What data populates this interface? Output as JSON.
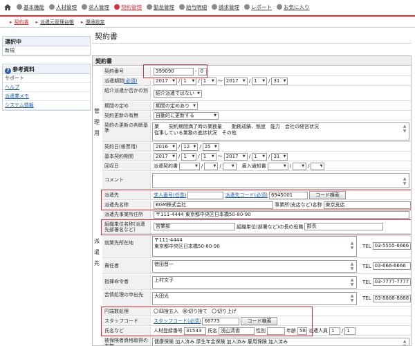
{
  "topnav": [
    "基本機能",
    "人材管理",
    "求人管理",
    "契約管理",
    "勤怠管理",
    "給与明細",
    "請求管理",
    "レポート",
    "お気に入り"
  ],
  "subnav": [
    "契約書",
    "派遣元管理台帳",
    "環境設定"
  ],
  "page_title": "契約書",
  "sidebar": {
    "selected_head": "選択中",
    "selected_item": "新規",
    "ref_head": "参考資料",
    "ref_items": [
      "サポート",
      "ヘルプ",
      "派遣業メモ",
      "システム情報"
    ]
  },
  "main": {
    "section_title": "契約書",
    "group_kanri": "管理用",
    "group_haken": "派遣先",
    "contract_no": {
      "label": "契約番号",
      "value": "399090",
      "sep": "-",
      "sub": "0"
    },
    "haken_period": {
      "label": "派遣期間",
      "required": "(必須)",
      "from": [
        "2017",
        "1",
        "1"
      ],
      "tilde": "〜",
      "to": [
        "2017",
        "1",
        "31"
      ]
    },
    "shokai": {
      "label": "紹介派遣か否かの別",
      "value": "紹介派遣ではない"
    },
    "kikan_sadame": {
      "label": "期間の定め",
      "value": "期間の定めあり"
    },
    "koushin": {
      "label": "契約更新の有無",
      "value": "自動的に更新する"
    },
    "koushin_handan": {
      "label": "契約の更新の判断基準",
      "line1": "業　　契約期間満了時の業務量　　勤務成績、態度　能力　会社の経営状況",
      "line2": "従事している業務の進捗状況　その他"
    },
    "contract_date": {
      "label": "契約日(帳票用)",
      "value": [
        "2016",
        "12",
        "25"
      ]
    },
    "kihon_period": {
      "label": "基本契約期間",
      "from": [
        "2017",
        "1",
        "1"
      ],
      "tilde": "〜",
      "to": [
        "2017",
        "1",
        "31"
      ]
    },
    "kaishu": {
      "label": "回収日",
      "haken": "派遣契約書",
      "sekinin": "雇入通知書"
    },
    "comment": {
      "label": "コメント"
    },
    "hakensaki": {
      "label": "派遣先",
      "kyujin_label": "求人番号(任意)",
      "code_label": "派遣先コード(必須)",
      "code_value": "6945001",
      "button": "コード検索"
    },
    "hakensaki_name": {
      "label": "派遣先名称",
      "value": "BGM株式会社",
      "office_label": "事業所(支店など)名称",
      "office_value": "東京支店"
    },
    "hakensaki_addr": {
      "label": "派遣先事業所住所",
      "value": "〒111-4444 東京都中央区日本橋50-80-90"
    },
    "soshiki": {
      "label": "組織単位名称(派遣先部署名など)",
      "value": "営業部",
      "head_label": "組織単位(部署など)の長の役職",
      "head_value": "部長"
    },
    "shugyo": {
      "label": "就業先所在地",
      "line1": "〒111-4444",
      "line2": "東京都中央区日本橋50-80-90",
      "tel_label": "TEL",
      "tel": "03-5555-6666"
    },
    "sekininsha": {
      "label": "責任者",
      "value": "徳田晋一",
      "tel_label": "TEL",
      "tel": "03-666-6666"
    },
    "shikimei": {
      "label": "指揮命令者",
      "value": "上村文子",
      "tel_label": "TEL",
      "tel": "03-7777-7777"
    },
    "kujo": {
      "label": "苦情処理の申出先",
      "value": "大田光",
      "tel_label": "TEL",
      "tel": "03-8888-8888"
    },
    "hasu": {
      "label": "円端数処理",
      "options": [
        "四捨五入",
        "切り捨て",
        "切り上げ"
      ]
    },
    "staff": {
      "label": "スタッフコード",
      "code_label": "スタッフコード(必須)",
      "code_value": "66773",
      "button": "コード検索"
    },
    "name": {
      "label": "氏名など",
      "reg_label": "人材登録番号",
      "reg_value": "31543",
      "name_label": "氏名",
      "name_value": "浅山清香",
      "sex_label": "性別",
      "age_label": "年齢",
      "age_value": "58",
      "count_label": "派遣人員",
      "count_a": "1",
      "count_sep": "/",
      "count_b": "1"
    },
    "hoken": {
      "label": "被保険者資格取得の有無",
      "value": "健康保険 加入済み 厚生年金保険 加入済み 雇用保険 加入済み"
    }
  }
}
